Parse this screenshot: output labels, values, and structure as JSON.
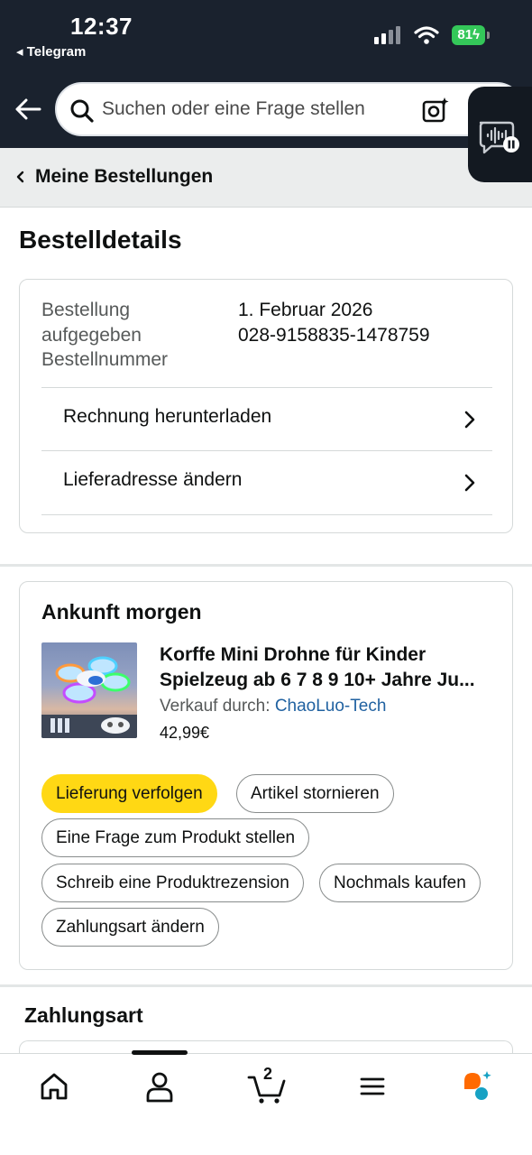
{
  "status_bar": {
    "time": "12:37",
    "back_app": "◂ Telegram",
    "battery": "81"
  },
  "search": {
    "placeholder": "Suchen oder eine Frage stellen"
  },
  "breadcrumb": {
    "label": "Meine Bestellungen"
  },
  "page": {
    "title": "Bestelldetails"
  },
  "order_info": {
    "labels": [
      "Bestellung",
      "aufgegeben",
      "Bestellnummer"
    ],
    "date": "1. Februar 2026",
    "order_number": "028-9158835-1478759",
    "links": [
      {
        "label": "Rechnung herunterladen"
      },
      {
        "label": "Lieferadresse ändern"
      }
    ]
  },
  "delivery": {
    "arrival": "Ankunft morgen",
    "product": {
      "title_line1": "Korffe Mini Drohne für Kinder",
      "title_line2": "Spielzeug ab 6 7 8 9 10+ Jahre Ju...",
      "sold_by_label": "Verkauf durch:",
      "seller": "ChaoLuo-Tech",
      "price": "42,99€"
    },
    "actions": {
      "track": "Lieferung verfolgen",
      "cancel": "Artikel stornieren",
      "question": "Eine Frage zum Produkt stellen",
      "review": "Schreib eine Produktrezension",
      "buy_again": "Nochmals kaufen",
      "change_payment": "Zahlungsart ändern"
    }
  },
  "payment": {
    "title": "Zahlungsart"
  },
  "bottom_nav": {
    "cart_count": "2",
    "items": [
      "home-icon",
      "account-icon",
      "cart-icon",
      "menu-icon",
      "rufus-icon"
    ]
  },
  "colors": {
    "header_bg": "#1a222e",
    "primary_button": "#ffd814",
    "link": "#2162a1",
    "battery": "#34c759"
  }
}
